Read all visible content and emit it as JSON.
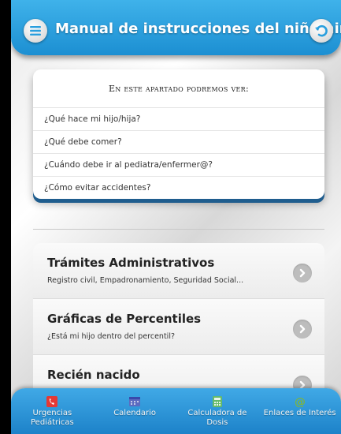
{
  "header": {
    "title": "Manual de instrucciones del niño/niña",
    "menu_icon": "menu-icon",
    "back_icon": "back-arrow-icon",
    "accent_color": "#2a9fde"
  },
  "info_card": {
    "heading": "En este apartado podremos ver:",
    "items": [
      "¿Qué hace mi hijo/hija?",
      "¿Qué debe comer?",
      "¿Cuándo debe ir al pediatra/enfermer@?",
      "¿Cómo evitar accidentes?"
    ]
  },
  "list": {
    "items": [
      {
        "title": "Trámites Administrativos",
        "subtitle": "Registro civil, Empadronamiento, Seguridad Social..."
      },
      {
        "title": "Gráficas de Percentiles",
        "subtitle": "¿Está mi hijo dentro del percentil?"
      },
      {
        "title": "Recién nacido",
        "subtitle": ""
      }
    ]
  },
  "bottom_nav": {
    "items": [
      {
        "label": "Urgencias Pediátricas",
        "icon": "phone-icon",
        "color": "#e53935"
      },
      {
        "label": "Calendario",
        "icon": "calendar-icon",
        "color": "#5c6bc0"
      },
      {
        "label": "Calculadora de Dosis",
        "icon": "calculator-icon",
        "color": "#66bb6a"
      },
      {
        "label": "Enlaces de Interés",
        "icon": "at-sign-icon",
        "color": "#7cb342"
      }
    ]
  }
}
